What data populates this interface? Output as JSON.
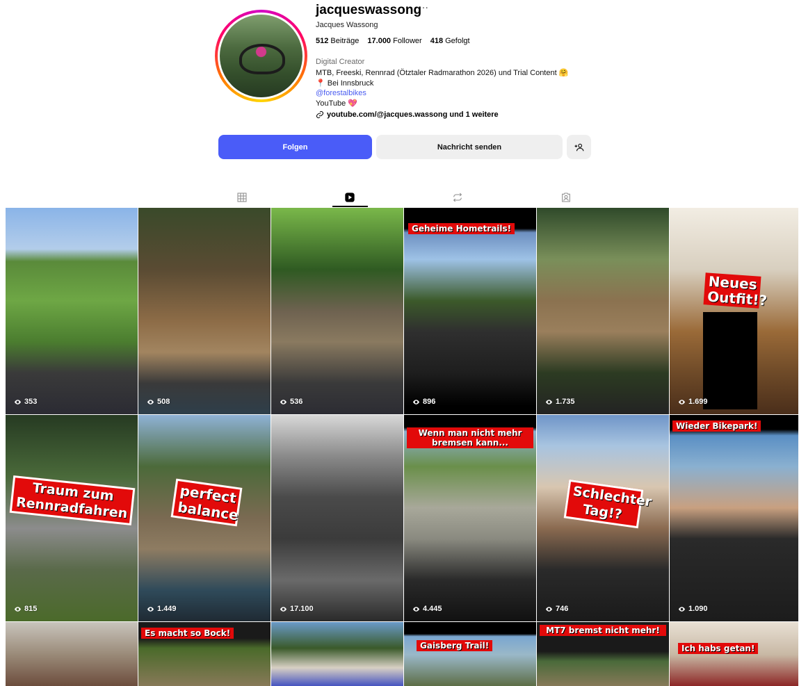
{
  "profile": {
    "username": "jacqueswassong",
    "more": "···",
    "full_name": "Jacques Wassong",
    "posts_count": "512",
    "posts_label": "Beiträge",
    "followers_count": "17.000",
    "followers_label": "Follower",
    "following_count": "418",
    "following_label": "Gefolgt",
    "category": "Digital Creator",
    "bio_line1": "MTB, Freeski, Rennrad (Ötztaler Radmarathon 2026) und Trial Content 🤗",
    "bio_line2": "📍 Bei Innsbruck",
    "bio_mention": "@forestalbikes",
    "bio_line4": "YouTube 💖",
    "link": "youtube.com/@jacques.wassong und 1 weitere"
  },
  "actions": {
    "follow": "Folgen",
    "message": "Nachricht senden",
    "add_user": "+8"
  },
  "tabs": [
    "posts-grid",
    "reels",
    "reposts",
    "tagged"
  ],
  "tiles": [
    {
      "views": "353",
      "caption": ""
    },
    {
      "views": "508",
      "caption": ""
    },
    {
      "views": "536",
      "caption": ""
    },
    {
      "views": "896",
      "caption": "Geheime Hometrails!"
    },
    {
      "views": "1.735",
      "caption": ""
    },
    {
      "views": "1.699",
      "caption": "Neues Outfit!?"
    },
    {
      "views": "815",
      "caption": "Traum zum Rennradfahren"
    },
    {
      "views": "1.449",
      "caption": "perfect balance"
    },
    {
      "views": "17.100",
      "caption": ""
    },
    {
      "views": "4.445",
      "caption": "Wenn man nicht mehr bremsen kann..."
    },
    {
      "views": "746",
      "caption": "Schlechter Tag!?"
    },
    {
      "views": "1.090",
      "caption": "Wieder Bikepark!"
    },
    {
      "caption": ""
    },
    {
      "caption": "Es macht so Bock!"
    },
    {
      "caption": ""
    },
    {
      "caption": "Gaisberg Trail!"
    },
    {
      "caption": "MT7 bremst nicht mehr!"
    },
    {
      "caption": "Ich habs getan!"
    }
  ],
  "colors": {
    "accent": "#4a5cf8",
    "caption_red": "#e20a0a"
  }
}
